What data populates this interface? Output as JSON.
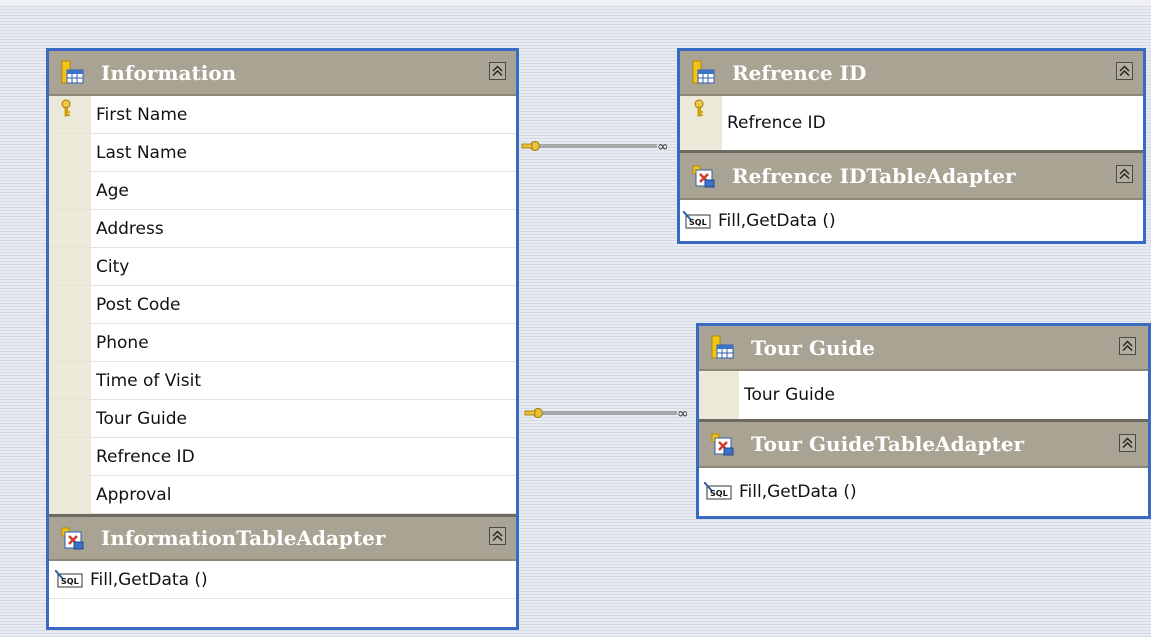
{
  "tables": {
    "information": {
      "title": "Information",
      "fields": [
        "First Name",
        "Last Name",
        "Age",
        "Address",
        "City",
        "Post Code",
        "Phone",
        "Time of Visit",
        "Tour Guide",
        "Refrence ID",
        "Approval"
      ],
      "adapter": {
        "title": "InformationTableAdapter",
        "method": "Fill,GetData ()"
      }
    },
    "refrence_id": {
      "title": "Refrence ID",
      "fields": [
        "Refrence ID"
      ],
      "adapter": {
        "title": "Refrence IDTableAdapter",
        "method": "Fill,GetData ()"
      }
    },
    "tour_guide": {
      "title": "Tour Guide",
      "fields": [
        "Tour Guide"
      ],
      "adapter": {
        "title": "Tour GuideTableAdapter",
        "method": "Fill,GetData ()"
      }
    }
  },
  "relations": [
    {
      "from": "Information",
      "to": "Refrence ID",
      "from_end": "key-icon",
      "to_end": "infinity-icon"
    },
    {
      "from": "Information",
      "to": "Tour Guide",
      "from_end": "key-icon",
      "to_end": "infinity-icon"
    }
  ],
  "icons": {
    "table": "table-icon",
    "adapter": "table-adapter-icon",
    "primary_key": "primary-key-icon",
    "query": "sql-query-icon",
    "collapse": "collapse-icon"
  },
  "colors": {
    "panel_border": "#3a6bc4",
    "header_bg": "#a9a394",
    "gutter_bg": "#ece9d8"
  }
}
